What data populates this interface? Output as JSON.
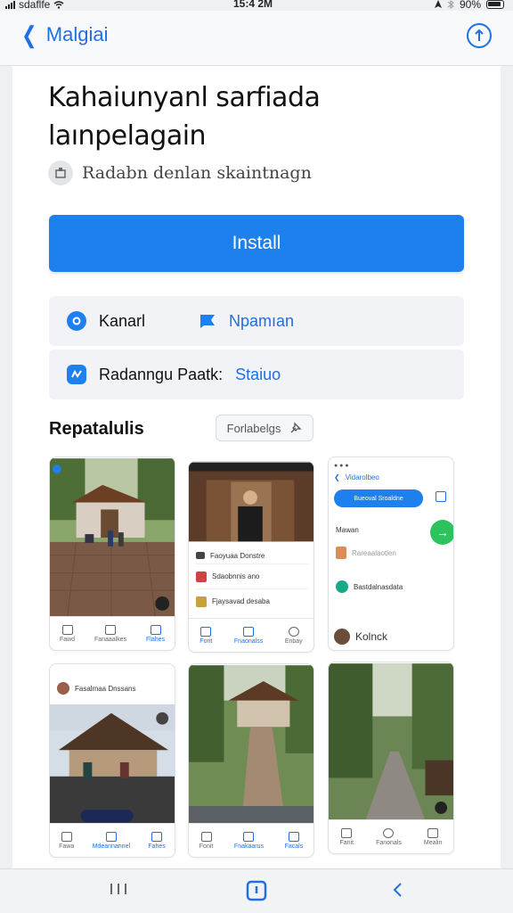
{
  "status": {
    "carrier": "sdaflfe",
    "time": "15:4 2M",
    "battery": "90%"
  },
  "nav": {
    "back_label": "Malgiai"
  },
  "app": {
    "title_line1": "Kahaiunyanl sarfiada",
    "title_line2": "laınpelagain",
    "subtitle": "Radabn denlan skaintnagn",
    "install_label": "Install"
  },
  "info": {
    "item1_label": "Kanarl",
    "item2_label": "Npamıan",
    "item3_label": "Radanngu Paatk:",
    "item3_link": "Staiuo"
  },
  "section": {
    "title": "Repatalulis",
    "filter_label": "Forlabelgs"
  },
  "shots": {
    "s1": {
      "tabs": [
        "Fawd",
        "Fanaaalkes",
        "Flahes"
      ]
    },
    "s2": {
      "row1": "Faoyuaa Donstre",
      "row2": "Sdaobnnis ano",
      "row3": "Fjaysavad desaba",
      "tabs": [
        "Forit",
        "Fnaonalss",
        "Enbay"
      ]
    },
    "s3": {
      "top_label": "Vidarolbeo",
      "pill": "Bueoval Sroaldne",
      "row_a": "Mawan",
      "row_b": "Rareaalaotlen",
      "row_c": "Bastdalnasdata",
      "bottom_label": "Kolnck"
    },
    "s4": {
      "header": "Fasalmaa Dnssans",
      "tabs": [
        "Fawa",
        "Mdeannannel",
        "Fahes"
      ]
    },
    "s5": {
      "tabs": [
        "Fonit",
        "Fnakaarus",
        "Facals"
      ]
    },
    "s6": {
      "tabs": [
        "Fanit",
        "Fanonals",
        "Mealin"
      ]
    }
  },
  "colors": {
    "accent": "#1e80ec",
    "link": "#1f6fe5",
    "green": "#2cc25c"
  }
}
